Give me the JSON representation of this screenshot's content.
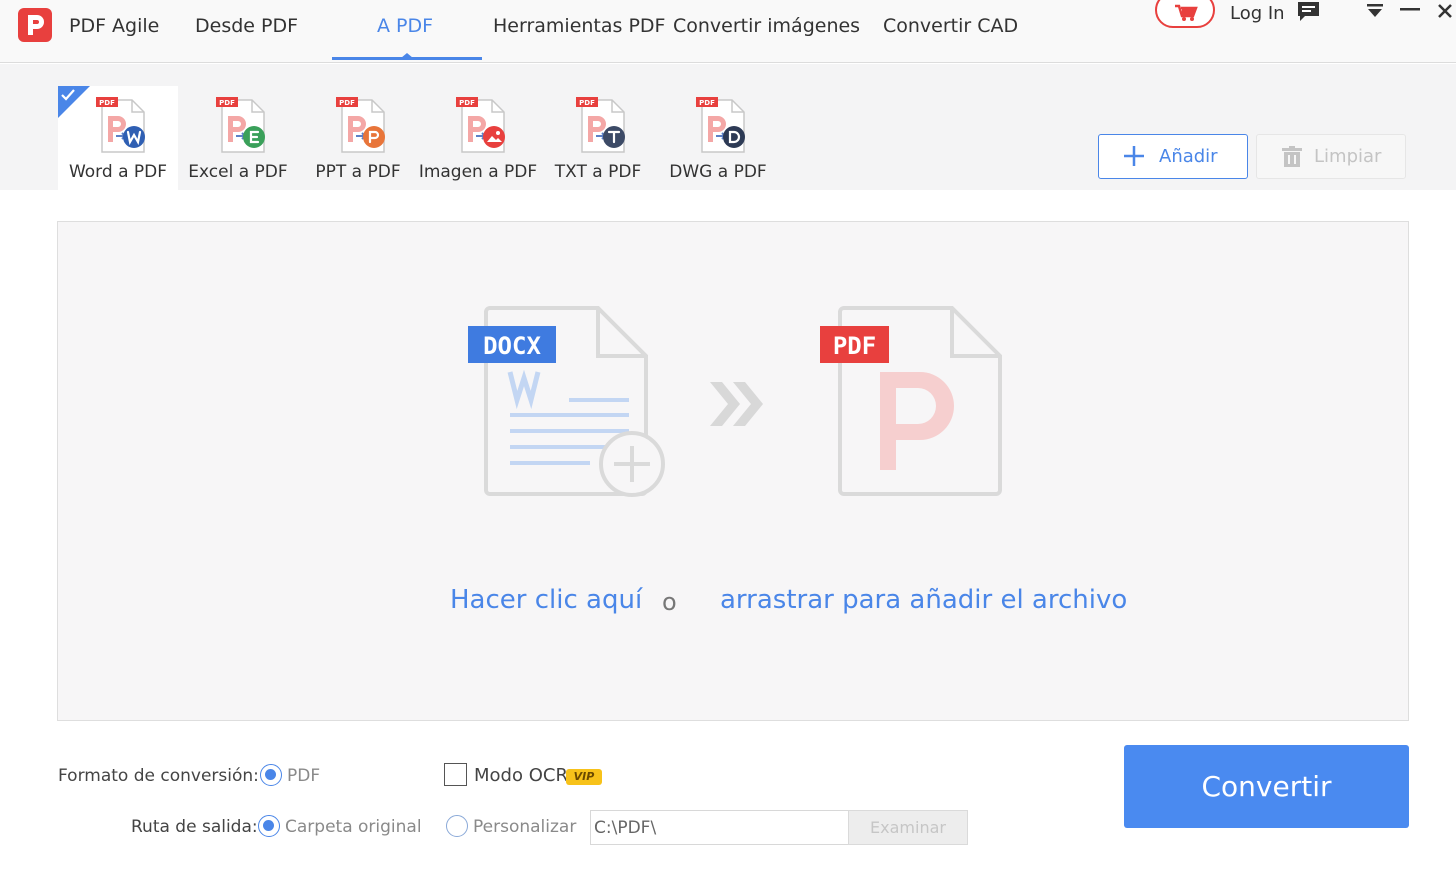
{
  "app": {
    "name": "PDF Agile"
  },
  "nav": {
    "items": [
      {
        "label": "Desde PDF"
      },
      {
        "label": "A PDF"
      },
      {
        "label": "Herramientas PDF"
      },
      {
        "label": "Convertir imágenes"
      },
      {
        "label": "Convertir CAD"
      }
    ],
    "active": "A PDF"
  },
  "header": {
    "login_label": "Log In"
  },
  "tools": {
    "items": [
      {
        "label": "Word a PDF",
        "badge": "W",
        "badge_color": "#2f5fb3",
        "selected": true
      },
      {
        "label": "Excel a PDF",
        "badge": "E",
        "badge_color": "#3aa05a",
        "selected": false
      },
      {
        "label": "PPT a PDF",
        "badge": "P",
        "badge_color": "#e8753a",
        "selected": false
      },
      {
        "label": "Imagen a PDF",
        "badge": "img",
        "badge_color": "#e8403e",
        "selected": false
      },
      {
        "label": "TXT a PDF",
        "badge": "T",
        "badge_color": "#3c4a66",
        "selected": false
      },
      {
        "label": "DWG a PDF",
        "badge": "D",
        "badge_color": "#2d3a55",
        "selected": false
      }
    ],
    "doc_tag": "PDF",
    "add_label": "Añadir",
    "clear_label": "Limpiar"
  },
  "dropzone": {
    "source_tag": "DOCX",
    "target_tag": "PDF",
    "click_label": "Hacer clic aquí",
    "or_label": "o",
    "drag_label": "arrastrar para añadir el archivo"
  },
  "settings": {
    "format_label": "Formato de conversión:",
    "format_option": "PDF",
    "ocr_label": "Modo OCR",
    "ocr_badge": "VIP",
    "ocr_checked": false,
    "output_label": "Ruta de salida:",
    "output_original": "Carpeta original",
    "output_custom": "Personalizar",
    "output_selected": "Carpeta original",
    "path_value": "C:\\PDF\\",
    "browse_label": "Examinar",
    "convert_label": "Convertir"
  },
  "colors": {
    "accent": "#4a86e8",
    "brand_red": "#e8403e",
    "convert_button": "#4a8af0"
  }
}
